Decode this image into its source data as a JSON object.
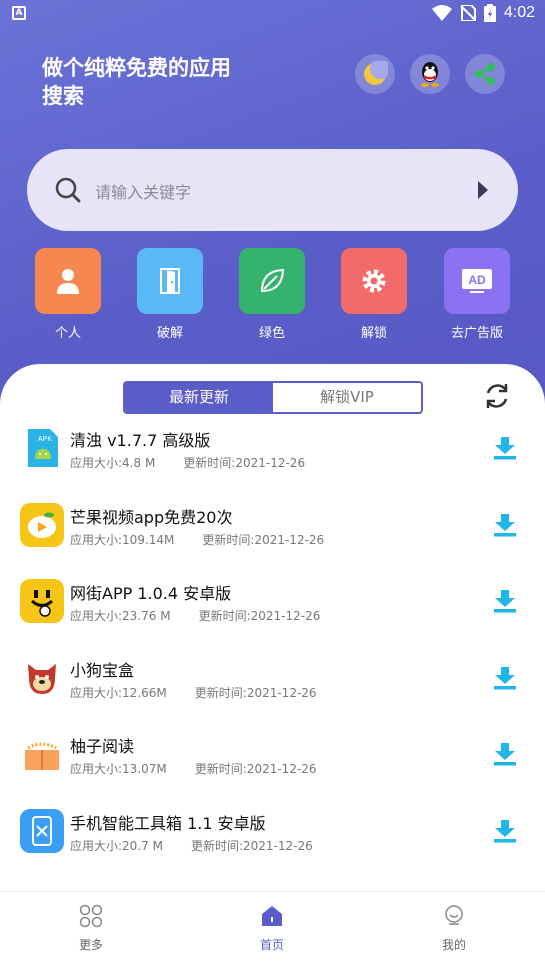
{
  "status": {
    "time": "4:02",
    "left_glyph": "A"
  },
  "header": {
    "slogan": "做个纯粹免费的应用搜索",
    "actions": [
      "moon-icon",
      "qq-icon",
      "share-icon"
    ]
  },
  "search": {
    "placeholder": "请输入关键字"
  },
  "categories": [
    {
      "label": "个人",
      "icon": "person-icon",
      "color": "#f7864f"
    },
    {
      "label": "破解",
      "icon": "door-icon",
      "color": "#5ab8f7"
    },
    {
      "label": "绿色",
      "icon": "leaf-icon",
      "color": "#35b36d"
    },
    {
      "label": "解锁",
      "icon": "gear-icon",
      "color": "#f36a6a"
    },
    {
      "label": "去广告版",
      "icon": "ad-icon",
      "color": "#8a72f2"
    }
  ],
  "tabs": {
    "latest": "最新更新",
    "unlock_vip": "解锁VIP"
  },
  "apps": [
    {
      "name": "清浊 v1.7.7 高级版",
      "size": "应用大小:4.8 M",
      "updated": "更新时间:2021-12-26",
      "icon": "apk-icon"
    },
    {
      "name": "芒果视频app免费20次",
      "size": "应用大小:109.14M",
      "updated": "更新时间:2021-12-26",
      "icon": "mango-icon"
    },
    {
      "name": "网街APP 1.0.4 安卓版",
      "size": "应用大小:23.76 M",
      "updated": "更新时间:2021-12-26",
      "icon": "smiley-icon"
    },
    {
      "name": "小狗宝盒",
      "size": "应用大小:12.66M",
      "updated": "更新时间:2021-12-26",
      "icon": "dog-icon"
    },
    {
      "name": "柚子阅读",
      "size": "应用大小:13.07M",
      "updated": "更新时间:2021-12-26",
      "icon": "book-icon"
    },
    {
      "name": "手机智能工具箱 1.1 安卓版",
      "size": "应用大小:20.7 M",
      "updated": "更新时间:2021-12-26",
      "icon": "toolbox-icon"
    }
  ],
  "bottom_nav": {
    "more": "更多",
    "home": "首页",
    "mine": "我的"
  },
  "colors": {
    "accent": "#5a5cc9",
    "download": "#1fb6e8"
  }
}
